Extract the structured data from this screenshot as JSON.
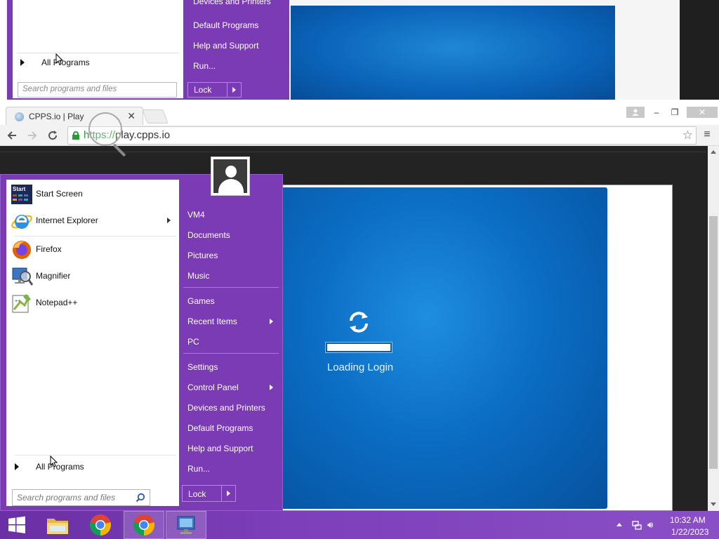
{
  "echo": {
    "items": [
      "Devices and Printers",
      "Default Programs",
      "Help and Support",
      "Run..."
    ],
    "all_programs": "All Programs",
    "search_placeholder": "Search programs and files",
    "lock": "Lock"
  },
  "browser": {
    "tab_title": "CPPS.io | Play",
    "tab_close": "✕",
    "url_scheme": "https://",
    "url_host": "play.cpps.io",
    "window_controls": {
      "minimize": "–",
      "maximize": "❐",
      "close": "✕"
    }
  },
  "game": {
    "loading_text": "Loading Login",
    "loading_progress": 1.0,
    "background_color": "#0b6dc4"
  },
  "start_menu": {
    "programs": [
      {
        "label": "Start Screen",
        "icon": "start-screen-icon",
        "has_submenu": false
      },
      {
        "label": "Internet Explorer",
        "icon": "internet-explorer-icon",
        "has_submenu": true
      },
      {
        "label": "Firefox",
        "icon": "firefox-icon",
        "has_submenu": false
      },
      {
        "label": "Magnifier",
        "icon": "magnifier-icon",
        "has_submenu": false
      },
      {
        "label": "Notepad++",
        "icon": "notepad-plus-plus-icon",
        "has_submenu": false
      }
    ],
    "start_screen_icon_text": "Start",
    "all_programs": "All Programs",
    "search_placeholder": "Search programs and files",
    "right_items": [
      {
        "label": "VM4",
        "has_submenu": false
      },
      {
        "label": "Documents",
        "has_submenu": false
      },
      {
        "label": "Pictures",
        "has_submenu": false
      },
      {
        "label": "Music",
        "has_submenu": false
      },
      {
        "label": "Games",
        "has_submenu": false
      },
      {
        "label": "Recent Items",
        "has_submenu": true
      },
      {
        "label": "PC",
        "has_submenu": false
      },
      {
        "label": "Settings",
        "has_submenu": false
      },
      {
        "label": "Control Panel",
        "has_submenu": true
      },
      {
        "label": "Devices and Printers",
        "has_submenu": false
      },
      {
        "label": "Default Programs",
        "has_submenu": false
      },
      {
        "label": "Help and Support",
        "has_submenu": false
      },
      {
        "label": "Run...",
        "has_submenu": false
      }
    ],
    "lock_label": "Lock",
    "accent_color": "#7b3bb4"
  },
  "taskbar": {
    "pinned": [
      "start-button",
      "file-explorer-icon",
      "chrome-icon",
      "chrome-icon-active",
      "remote-desktop-icon"
    ],
    "clock_time": "10:32 AM",
    "clock_date": "1/22/2023"
  }
}
